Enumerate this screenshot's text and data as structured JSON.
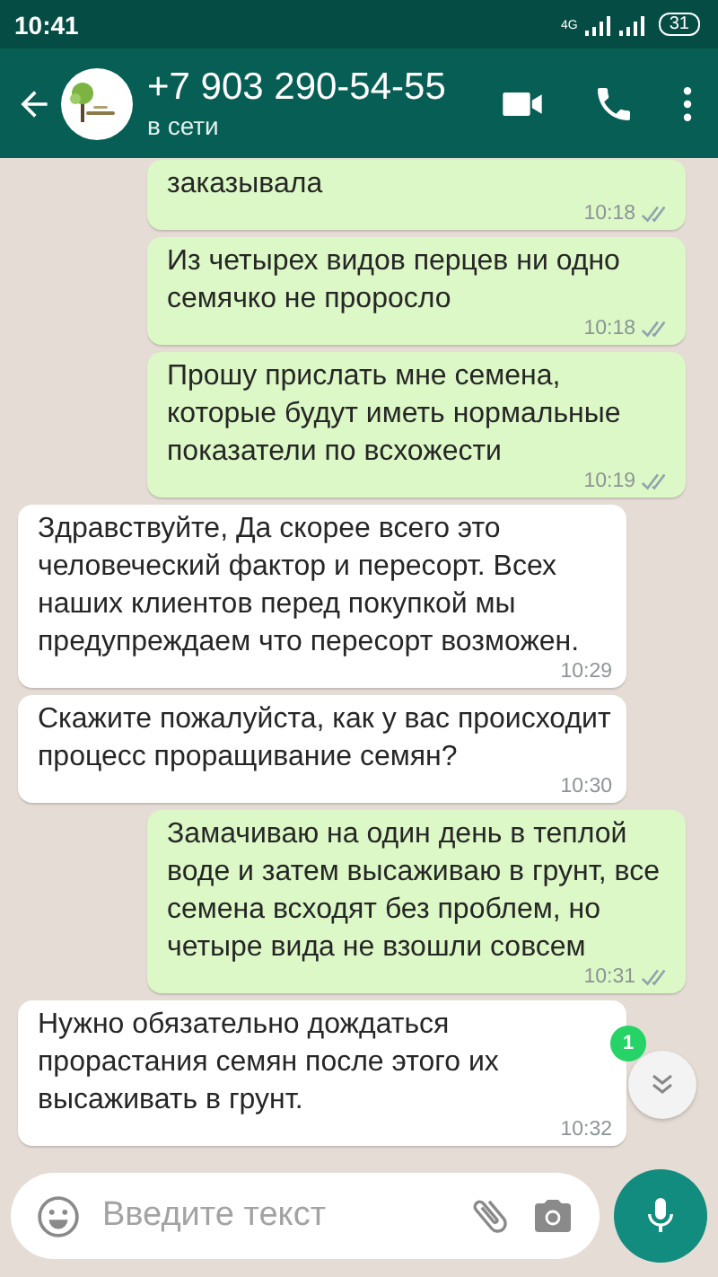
{
  "status_bar": {
    "time": "10:41",
    "network": "4G",
    "battery": "31"
  },
  "header": {
    "title": "+7 903 290-54-55",
    "status": "в сети"
  },
  "messages": [
    {
      "kind": "out",
      "text": "заказывала",
      "time": "10:18",
      "delivered": true
    },
    {
      "kind": "out",
      "text": "Из четырех видов перцев ни одно семячко не проросло",
      "time": "10:18",
      "delivered": true
    },
    {
      "kind": "out",
      "text": "Прошу прислать мне семена, которые будут иметь нормальные показатели по всхожести",
      "time": "10:19",
      "delivered": true
    },
    {
      "kind": "in",
      "text": "Здравствуйте, Да скорее всего это человеческий фактор и пересорт. Всех наших клиентов перед покупкой мы предупреждаем что пересорт возможен.",
      "time": "10:29"
    },
    {
      "kind": "in",
      "text": "Скажите пожалуйста, как у вас происходит процесс проращивание семян?",
      "time": "10:30"
    },
    {
      "kind": "out",
      "text": "Замачиваю на один день в теплой воде и затем высаживаю в грунт, все семена всходят без проблем, но четыре вида не взошли совсем",
      "time": "10:31",
      "delivered": true
    },
    {
      "kind": "in",
      "text": "Нужно обязательно дождаться прорастания семян после этого их высаживать в грунт.",
      "time": "10:32"
    }
  ],
  "unread_badge": "1",
  "composer": {
    "placeholder": "Введите текст"
  }
}
